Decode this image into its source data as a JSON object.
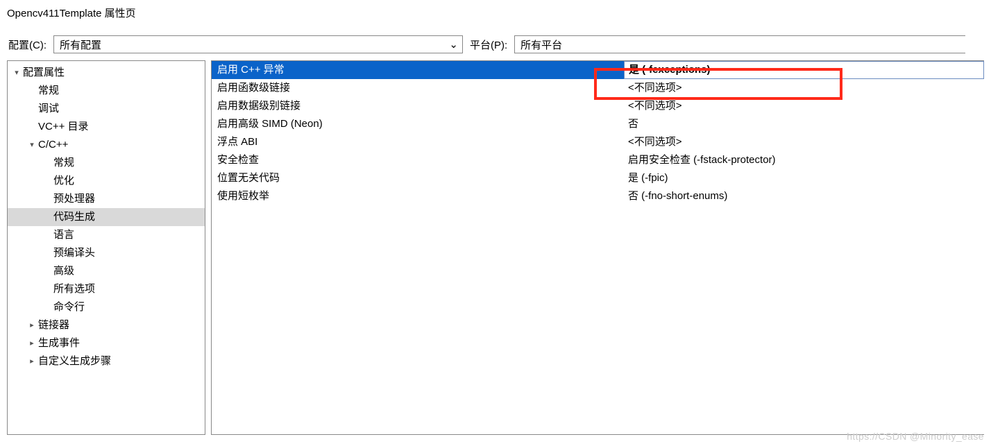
{
  "window": {
    "title": "Opencv411Template 属性页"
  },
  "toolbar": {
    "config_label": "配置(C):",
    "config_value": "所有配置",
    "platform_label": "平台(P):",
    "platform_value": "所有平台"
  },
  "tree": {
    "root": "配置属性",
    "items": {
      "general": "常规",
      "debug": "调试",
      "vcdirs": "VC++ 目录",
      "ccpp": "C/C++",
      "ccpp_general": "常规",
      "ccpp_optimize": "优化",
      "ccpp_preproc": "预处理器",
      "ccpp_codegen": "代码生成",
      "ccpp_lang": "语言",
      "ccpp_pch": "预编译头",
      "ccpp_adv": "高级",
      "ccpp_all": "所有选项",
      "ccpp_cmd": "命令行",
      "linker": "链接器",
      "buildevents": "生成事件",
      "custombuild": "自定义生成步骤"
    }
  },
  "grid": [
    {
      "name": "启用 C++ 异常",
      "value": "是 (-fexceptions)",
      "selected": true
    },
    {
      "name": "启用函数级链接",
      "value": "<不同选项>"
    },
    {
      "name": "启用数据级别链接",
      "value": "<不同选项>"
    },
    {
      "name": "启用高级 SIMD (Neon)",
      "value": "否"
    },
    {
      "name": "浮点 ABI",
      "value": "<不同选项>"
    },
    {
      "name": "安全检查",
      "value": "启用安全检查 (-fstack-protector)"
    },
    {
      "name": "位置无关代码",
      "value": "是 (-fpic)"
    },
    {
      "name": "使用短枚举",
      "value": "否 (-fno-short-enums)"
    }
  ],
  "watermark": "https://CSDN @Minority_ease",
  "glyph": {
    "down": "▾",
    "right": "▸",
    "chev": "⌄"
  }
}
